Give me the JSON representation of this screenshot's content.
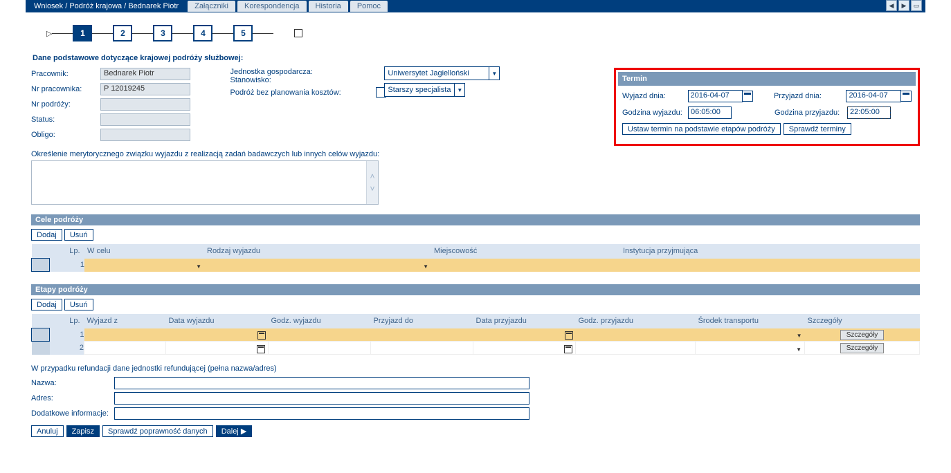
{
  "tabs": {
    "active": "Wniosek / Podróż krajowa / Bednarek Piotr",
    "others": [
      "Załączniki",
      "Korespondencja",
      "Historia",
      "Pomoc"
    ]
  },
  "wizard": {
    "steps": [
      "1",
      "2",
      "3",
      "4",
      "5"
    ],
    "active": 0
  },
  "section_title": "Dane podstawowe dotyczące krajowej podróży służbowej:",
  "basic": {
    "pracownik": {
      "label": "Pracownik:",
      "value": "Bednarek Piotr"
    },
    "nr_prac": {
      "label": "Nr pracownika:",
      "value": "P 12019245"
    },
    "nr_podrozy": {
      "label": "Nr podróży:",
      "value": ""
    },
    "status": {
      "label": "Status:",
      "value": ""
    },
    "obligo": {
      "label": "Obligo:",
      "value": ""
    },
    "jednostka": {
      "label": "Jednostka gospodarcza:",
      "value": "Uniwersytet Jagielloński"
    },
    "stanowisko": {
      "label": "Stanowisko:",
      "value": "Starszy specjalista"
    },
    "bez_plan": {
      "label": "Podróż bez planowania kosztów:"
    }
  },
  "termin": {
    "title": "Termin",
    "wyjazd_dnia": {
      "label": "Wyjazd dnia:",
      "value": "2016-04-07"
    },
    "przyjazd_dnia": {
      "label": "Przyjazd dnia:",
      "value": "2016-04-07"
    },
    "godz_wyj": {
      "label": "Godzina wyjazdu:",
      "value": "06:05:00"
    },
    "godz_przy": {
      "label": "Godzina przyjazdu:",
      "value": "22:05:00"
    },
    "btn_ustaw": "Ustaw termin na podstawie etapów podróży",
    "btn_sprawdz": "Sprawdź terminy"
  },
  "okreslenie_label": "Określenie merytorycznego związku wyjazdu z realizacją zadań badawczych lub innych celów wyjazdu:",
  "cele": {
    "title": "Cele podróży",
    "btn_dodaj": "Dodaj",
    "btn_usun": "Usuń",
    "cols": {
      "lp": "Lp.",
      "wcelu": "W celu",
      "rodzaj": "Rodzaj wyjazdu",
      "miejsc": "Miejscowość",
      "inst": "Instytucja przyjmująca"
    },
    "rows": [
      {
        "lp": "1"
      }
    ]
  },
  "etapy": {
    "title": "Etapy podróży",
    "btn_dodaj": "Dodaj",
    "btn_usun": "Usuń",
    "cols": {
      "lp": "Lp.",
      "wyjazd_z": "Wyjazd z",
      "data_w": "Data wyjazdu",
      "godz_w": "Godz. wyjazdu",
      "przy_do": "Przyjazd do",
      "data_p": "Data przyjazdu",
      "godz_p": "Godz. przyjazdu",
      "srodek": "Środek transportu",
      "szcz": "Szczegóły"
    },
    "szcz_btn": "Szczegóły",
    "rows": [
      {
        "lp": "1"
      },
      {
        "lp": "2"
      }
    ]
  },
  "refund": {
    "title": "W przypadku refundacji dane jednostki refundującej (pełna nazwa/adres)",
    "nazwa": "Nazwa:",
    "adres": "Adres:",
    "dod": "Dodatkowe informacje:"
  },
  "buttons": {
    "anuluj": "Anuluj",
    "zapisz": "Zapisz",
    "sprawdz": "Sprawdź poprawność danych",
    "dalej": "Dalej"
  }
}
